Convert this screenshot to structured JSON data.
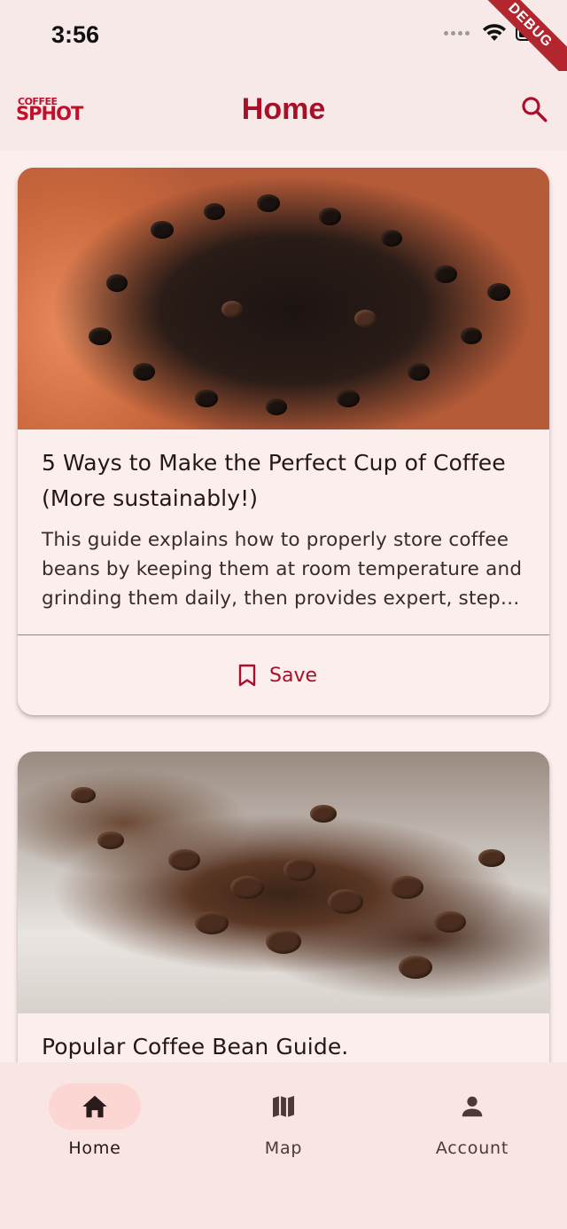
{
  "status_bar": {
    "time": "3:56"
  },
  "debug_banner": "DEBUG",
  "app_bar": {
    "logo_line1": "COFFEE",
    "logo_line2": "SPHOT",
    "title": "Home"
  },
  "articles": [
    {
      "title": "5 Ways to Make the Perfect Cup of Coffee (More sustainably!)",
      "title_line1": "5 Ways to Make the Perfect Cup of Coffee",
      "title_line2": "(More sustainably!)",
      "desc_line1": "This guide explains how to properly store coffee",
      "desc_line2": "beans by keeping them at room temperature and",
      "desc_line3": "grinding them daily, then provides expert, step…",
      "save_label": "Save"
    },
    {
      "title": "Popular Coffee Bean Guide."
    }
  ],
  "bottom_nav": {
    "items": [
      {
        "label": "Home",
        "icon": "home-icon",
        "selected": true
      },
      {
        "label": "Map",
        "icon": "map-icon",
        "selected": false
      },
      {
        "label": "Account",
        "icon": "person-icon",
        "selected": false
      }
    ]
  },
  "colors": {
    "accent": "#a8102a",
    "background": "#fdeeee",
    "app_bar": "#f6e9e8",
    "nav_selected_pill": "#fbd6d3"
  }
}
